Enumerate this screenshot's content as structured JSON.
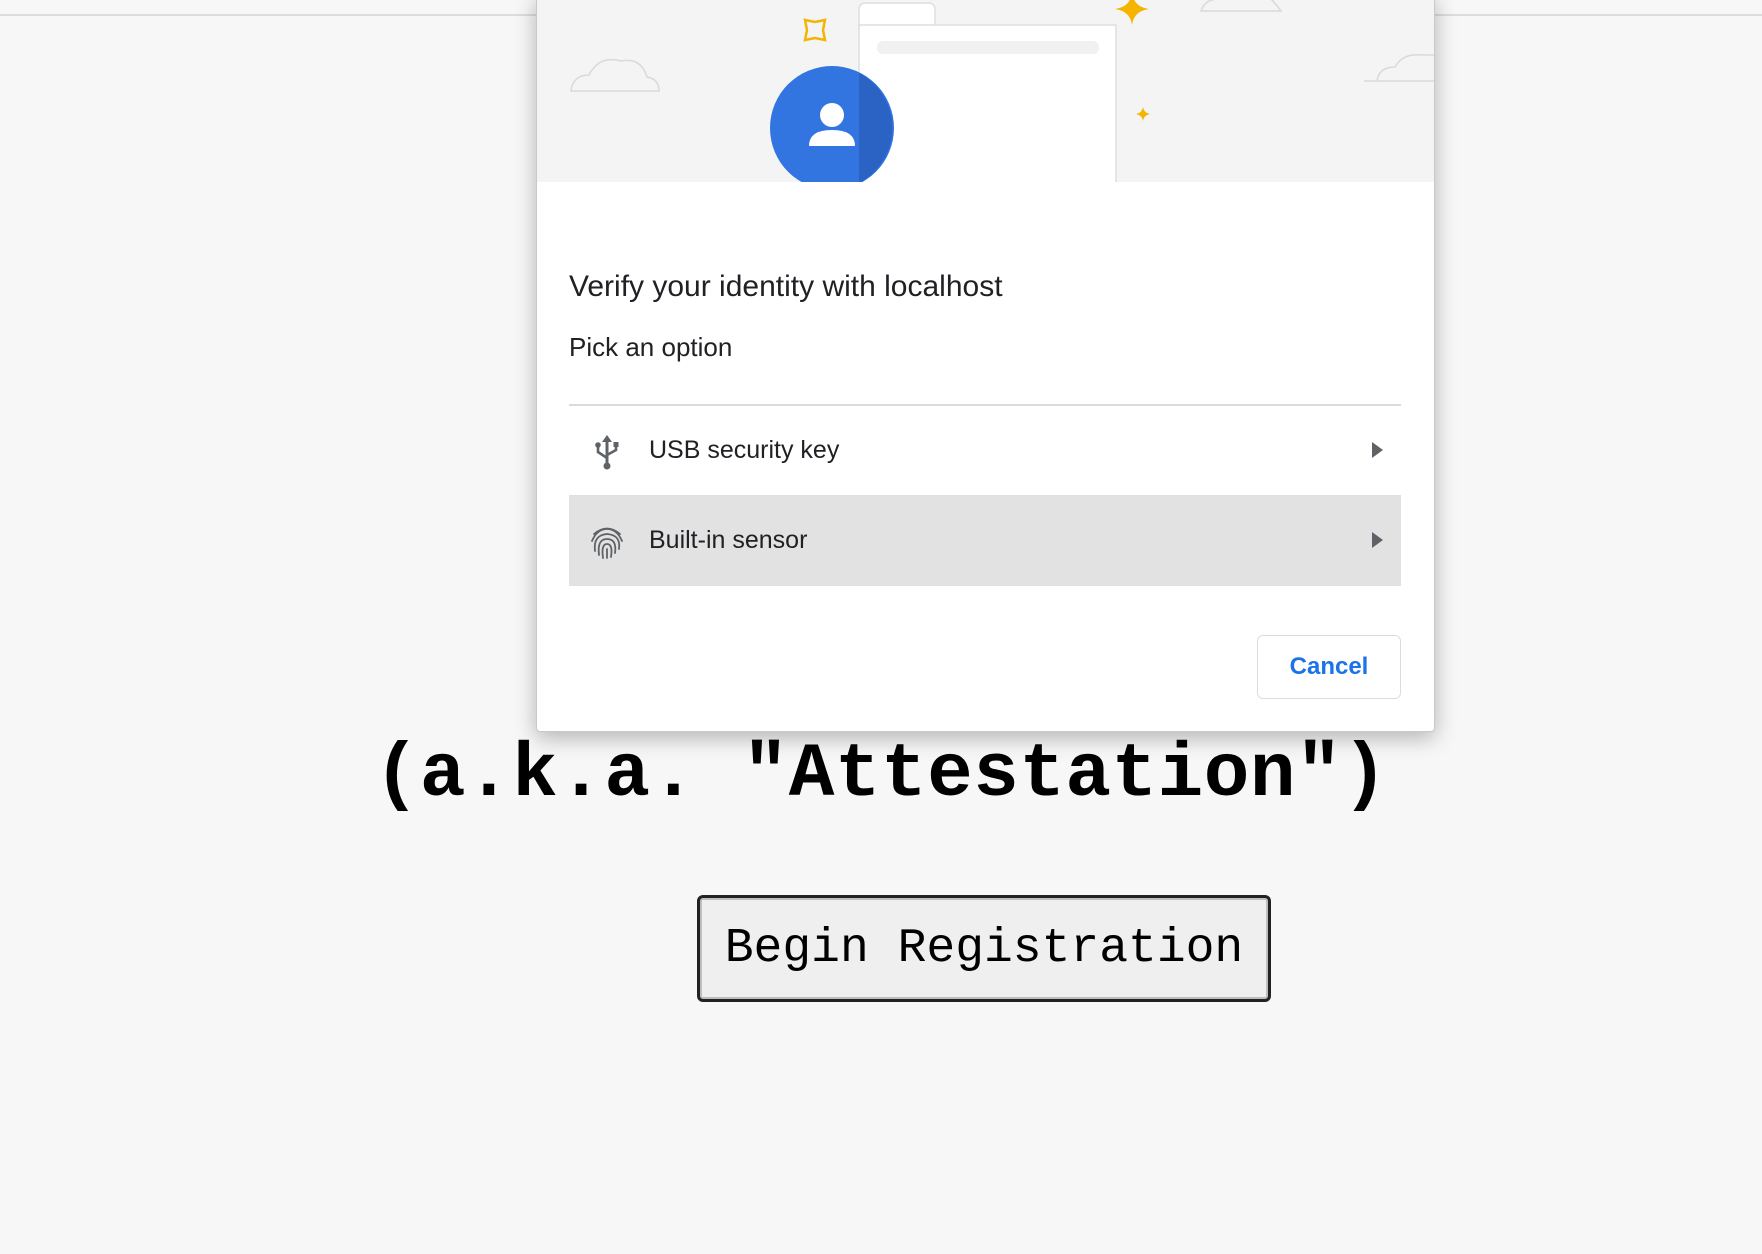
{
  "dialog": {
    "title": "Verify your identity with localhost",
    "subtitle": "Pick an option",
    "options": [
      {
        "label": "USB security key",
        "icon": "usb-icon",
        "selected": false
      },
      {
        "label": "Built-in sensor",
        "icon": "fingerprint-icon",
        "selected": true
      }
    ],
    "cancel_label": "Cancel",
    "colors": {
      "accent": "#1a73e8",
      "avatar": "#3275e0",
      "sparkle": "#f4b400"
    }
  },
  "page": {
    "aka_text": "(a.k.a. \"Attestation\")",
    "begin_label": "Begin Registration"
  }
}
